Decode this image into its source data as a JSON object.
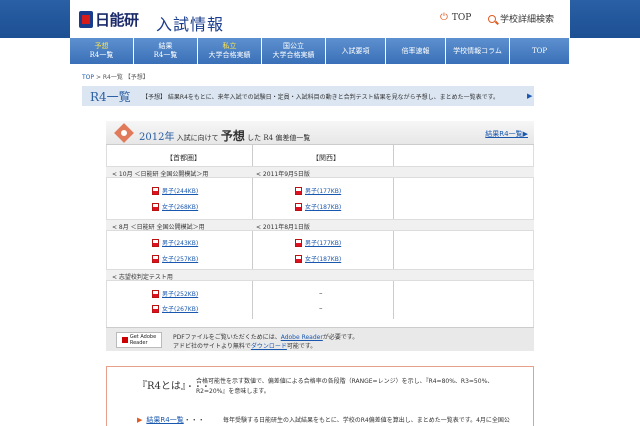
{
  "header": {
    "logo_text": "日能研",
    "title": "入試情報",
    "top_link": "TOP",
    "search_link": "学校詳細検索"
  },
  "nav": {
    "tabs": [
      {
        "l1": "予想",
        "l2": "R4一覧",
        "yellow": true
      },
      {
        "l1": "結果",
        "l2": "R4一覧",
        "yellow": false
      },
      {
        "l1": "私立",
        "l2": "大学合格実績",
        "yellow": true
      },
      {
        "l1": "国公立",
        "l2": "大学合格実績",
        "yellow": false
      },
      {
        "l1": "入試要項",
        "l2": "",
        "yellow": false
      },
      {
        "l1": "倍率速報",
        "l2": "",
        "yellow": false
      },
      {
        "l1": "学校情報コラム",
        "l2": "",
        "yellow": false
      },
      {
        "l1": "TOP",
        "l2": "",
        "yellow": false
      }
    ]
  },
  "breadcrumb": {
    "top": "TOP",
    "sep": ">",
    "current": "R4一覧 【予想】"
  },
  "page_heading": {
    "title": "R4一覧",
    "description": "【予想】 結果R4をもとに、来年入試での試験日・定員・入試科目の動きと合判テスト結果を見ながら予想し、まとめた一覧表です。",
    "arrow": "▶"
  },
  "table": {
    "title_year": "2012年",
    "title_mid": " 入試に向けて ",
    "title_big": "予想",
    "title_mid2": " した R4 ",
    "title_end": "偏差値一覧",
    "more_link": "結果R4一覧▶",
    "col_shuto": "【首都圏】",
    "col_kansai": "【関西】",
    "sections": [
      {
        "shuto": "< 10月 ＜日能研 全国公開模試＞用",
        "kansai": "< 2011年9月5日版"
      },
      {
        "shuto": "< 8月 ＜日能研 全国公開模試＞用",
        "kansai": "< 2011年8月1日版"
      },
      {
        "shuto": "< 志望校判定テスト用",
        "kansai": ""
      }
    ],
    "rows": [
      {
        "shuto": "男子(244KB)",
        "kansai": "男子(177KB)"
      },
      {
        "shuto": "女子(268KB)",
        "kansai": "女子(187KB)"
      },
      {
        "shuto": "男子(243KB)",
        "kansai": "男子(177KB)"
      },
      {
        "shuto": "女子(257KB)",
        "kansai": "女子(187KB)"
      },
      {
        "shuto": "男子(252KB)",
        "kansai": "–"
      },
      {
        "shuto": "女子(267KB)",
        "kansai": "–"
      }
    ]
  },
  "adobe": {
    "btn_line1": "Get Adobe",
    "btn_line2": "Reader",
    "line1_pre": "PDFファイルをご覧いただくためには、",
    "line1_link": "Adobe Reader",
    "line1_post": "が必要です。",
    "line2_pre": "アドビ社のサイトより無料で",
    "line2_link": "ダウンロード",
    "line2_post": "可能です。"
  },
  "r4": {
    "heading": "『R4とは』",
    "dots": "・・・",
    "desc": "合格可能性を示す数値で、偏差値による合格率の各段階（RANGE=レンジ）を示し、『R4=80%、R3=50%、R2=20%』を意味します。",
    "link": "結果R4一覧",
    "link_dots": "・・・",
    "link_desc": "毎年受験する日能研生の入試結果をもとに、学校のR4偏差値を算出し、まとめた一覧表です。4月に全国公"
  }
}
